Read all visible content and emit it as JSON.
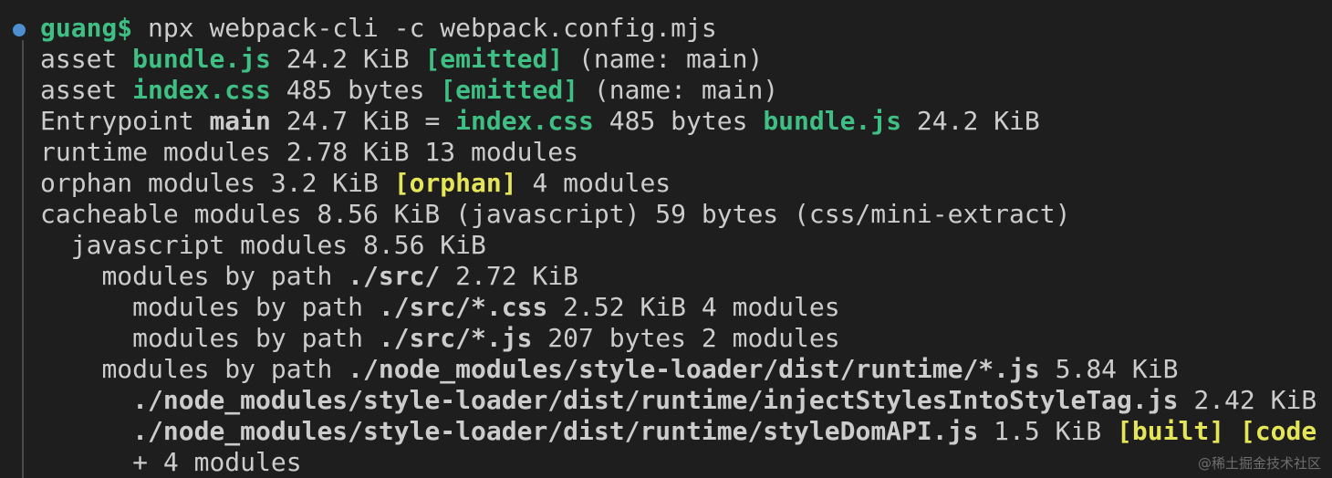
{
  "terminal": {
    "prompt_user": "guang$",
    "command": " npx webpack-cli -c webpack.config.mjs",
    "lines": [
      {
        "indent": "",
        "segments": [
          {
            "text": "asset ",
            "style": "plain"
          },
          {
            "text": "bundle.js",
            "style": "green"
          },
          {
            "text": " 24.2 KiB ",
            "style": "plain"
          },
          {
            "text": "[emitted]",
            "style": "green"
          },
          {
            "text": " (name: main)",
            "style": "plain"
          }
        ]
      },
      {
        "indent": "",
        "segments": [
          {
            "text": "asset ",
            "style": "plain"
          },
          {
            "text": "index.css",
            "style": "green"
          },
          {
            "text": " 485 bytes ",
            "style": "plain"
          },
          {
            "text": "[emitted]",
            "style": "green"
          },
          {
            "text": " (name: main)",
            "style": "plain"
          }
        ]
      },
      {
        "indent": "",
        "segments": [
          {
            "text": "Entrypoint ",
            "style": "plain"
          },
          {
            "text": "main",
            "style": "bold"
          },
          {
            "text": " 24.7 KiB = ",
            "style": "plain"
          },
          {
            "text": "index.css",
            "style": "green"
          },
          {
            "text": " 485 bytes ",
            "style": "plain"
          },
          {
            "text": "bundle.js",
            "style": "green"
          },
          {
            "text": " 24.2 KiB",
            "style": "plain"
          }
        ]
      },
      {
        "indent": "",
        "segments": [
          {
            "text": "runtime modules 2.78 KiB 13 modules",
            "style": "plain"
          }
        ]
      },
      {
        "indent": "",
        "segments": [
          {
            "text": "orphan modules 3.2 KiB ",
            "style": "plain"
          },
          {
            "text": "[orphan]",
            "style": "yellow"
          },
          {
            "text": " 4 modules",
            "style": "plain"
          }
        ]
      },
      {
        "indent": "",
        "segments": [
          {
            "text": "cacheable modules 8.56 KiB (javascript) 59 bytes (css/mini-extract)",
            "style": "plain"
          }
        ]
      },
      {
        "indent": "  ",
        "segments": [
          {
            "text": "javascript modules 8.56 KiB",
            "style": "plain"
          }
        ]
      },
      {
        "indent": "    ",
        "segments": [
          {
            "text": "modules by path ",
            "style": "plain"
          },
          {
            "text": "./src/",
            "style": "bold"
          },
          {
            "text": " 2.72 KiB",
            "style": "plain"
          }
        ]
      },
      {
        "indent": "      ",
        "segments": [
          {
            "text": "modules by path ",
            "style": "plain"
          },
          {
            "text": "./src/*.css",
            "style": "bold"
          },
          {
            "text": " 2.52 KiB 4 modules",
            "style": "plain"
          }
        ]
      },
      {
        "indent": "      ",
        "segments": [
          {
            "text": "modules by path ",
            "style": "plain"
          },
          {
            "text": "./src/*.js",
            "style": "bold"
          },
          {
            "text": " 207 bytes 2 modules",
            "style": "plain"
          }
        ]
      },
      {
        "indent": "    ",
        "segments": [
          {
            "text": "modules by path ",
            "style": "plain"
          },
          {
            "text": "./node_modules/style-loader/dist/runtime/*.js",
            "style": "bold"
          },
          {
            "text": " 5.84 KiB",
            "style": "plain"
          }
        ]
      },
      {
        "indent": "      ",
        "segments": [
          {
            "text": "./node_modules/style-loader/dist/runtime/injectStylesIntoStyleTag.js",
            "style": "bold"
          },
          {
            "text": " 2.42 KiB",
            "style": "plain"
          }
        ]
      },
      {
        "indent": "      ",
        "segments": [
          {
            "text": "./node_modules/style-loader/dist/runtime/styleDomAPI.js",
            "style": "bold"
          },
          {
            "text": " 1.5 KiB ",
            "style": "plain"
          },
          {
            "text": "[built]",
            "style": "yellow"
          },
          {
            "text": " [code",
            "style": "yellow"
          }
        ]
      },
      {
        "indent": "      ",
        "segments": [
          {
            "text": "+ 4 modules",
            "style": "plain"
          }
        ]
      }
    ]
  },
  "watermark": "@稀土掘金技术社区",
  "colors": {
    "background": "#1e1e1e",
    "text": "#cccccc",
    "green": "#3fbf84",
    "yellow": "#e5e55a",
    "prompt_dot": "#4d8fcf"
  }
}
